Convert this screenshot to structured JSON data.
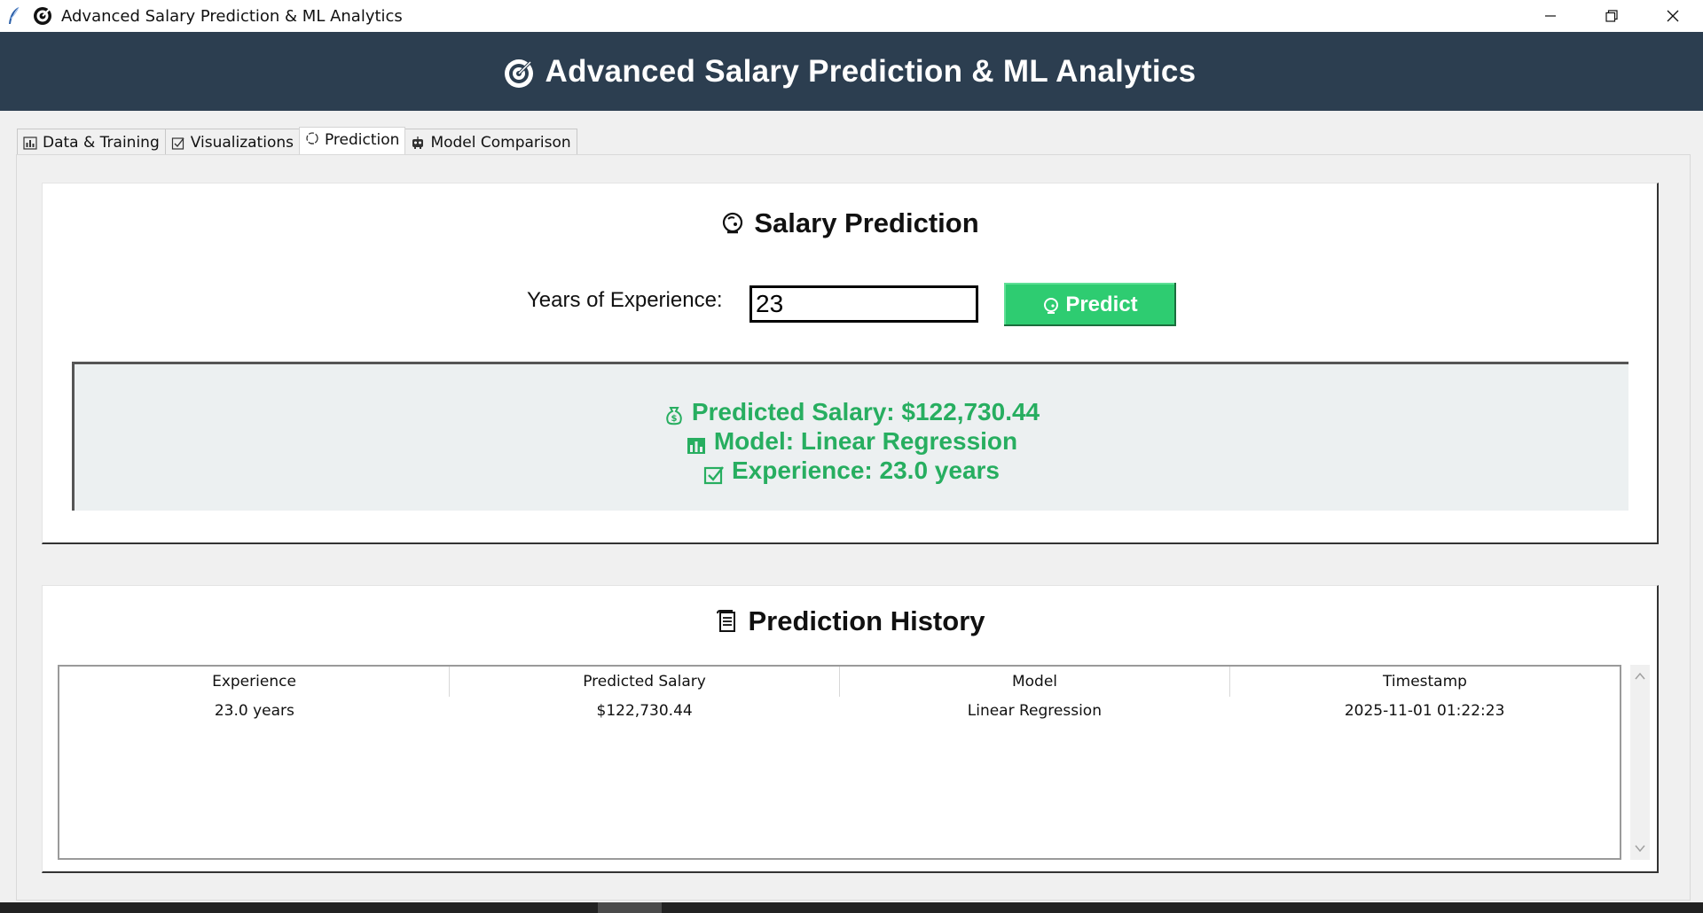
{
  "window": {
    "title": "Advanced Salary Prediction & ML Analytics"
  },
  "banner": {
    "title": "Advanced Salary Prediction & ML Analytics",
    "icon": "target-icon"
  },
  "tabs": [
    {
      "label": "Data & Training",
      "icon": "bar-chart-icon",
      "active": false
    },
    {
      "label": "Visualizations",
      "icon": "checkbox-icon",
      "active": false
    },
    {
      "label": "Prediction",
      "icon": "crystal-ball-icon",
      "active": true
    },
    {
      "label": "Model Comparison",
      "icon": "robot-icon",
      "active": false
    }
  ],
  "prediction": {
    "heading": "Salary Prediction",
    "input_label": "Years of Experience:",
    "input_value": "23",
    "predict_label": "Predict",
    "result": {
      "salary_line": "Predicted Salary: $122,730.44",
      "model_line": "Model: Linear Regression",
      "experience_line": "Experience: 23.0 years"
    }
  },
  "history": {
    "heading": "Prediction History",
    "columns": [
      "Experience",
      "Predicted Salary",
      "Model",
      "Timestamp"
    ],
    "rows": [
      [
        "23.0 years",
        "$122,730.44",
        "Linear Regression",
        "2025-11-01 01:22:23"
      ]
    ]
  },
  "colors": {
    "banner_bg": "#2c3e50",
    "accent_green": "#2ecc71",
    "result_text": "#27ae60",
    "result_bg": "#ecf0f1"
  }
}
